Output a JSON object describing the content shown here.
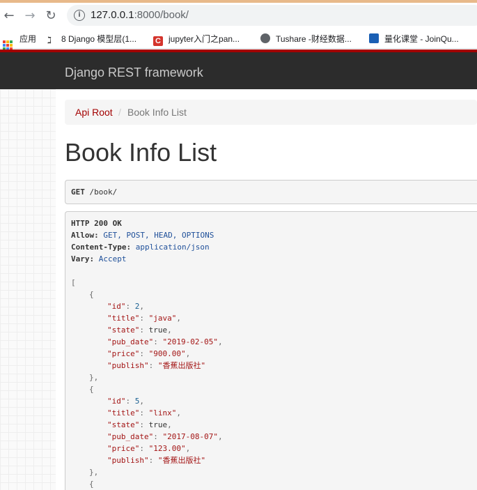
{
  "browser": {
    "url_host": "127.0.0.1",
    "url_rest": ":8000/book/",
    "bookmarks": [
      {
        "label": "应用"
      },
      {
        "label": "8 Django 模型层(1..."
      },
      {
        "label": "jupyter入门之pan..."
      },
      {
        "label": "Tushare -财经数据..."
      },
      {
        "label": "量化课堂 - JoinQu..."
      }
    ]
  },
  "navbar": {
    "brand": "Django REST framework"
  },
  "breadcrumb": {
    "root": "Api Root",
    "sep": "/",
    "current": "Book Info List"
  },
  "page": {
    "title": "Book Info List"
  },
  "request": {
    "method": "GET",
    "path": "/book/"
  },
  "response": {
    "status": "HTTP 200 OK",
    "headers": [
      {
        "name": "Allow:",
        "value": "GET, POST, HEAD, OPTIONS"
      },
      {
        "name": "Content-Type:",
        "value": "application/json"
      },
      {
        "name": "Vary:",
        "value": "Accept"
      }
    ],
    "body": [
      {
        "id": "2",
        "title": "\"java\"",
        "state": "true",
        "pub_date": "\"2019-02-05\"",
        "price": "\"900.00\"",
        "publish": "\"香蕉出版社\""
      },
      {
        "id": "5",
        "title": "\"linx\"",
        "state": "true",
        "pub_date": "\"2017-08-07\"",
        "price": "\"123.00\"",
        "publish": "\"香蕉出版社\""
      }
    ],
    "keys": {
      "id": "\"id\"",
      "title": "\"title\"",
      "state": "\"state\"",
      "pub_date": "\"pub_date\"",
      "price": "\"price\"",
      "publish": "\"publish\""
    }
  },
  "colors": {
    "brand_red": "#a30000",
    "navbar_bg": "#2c2c2c"
  }
}
